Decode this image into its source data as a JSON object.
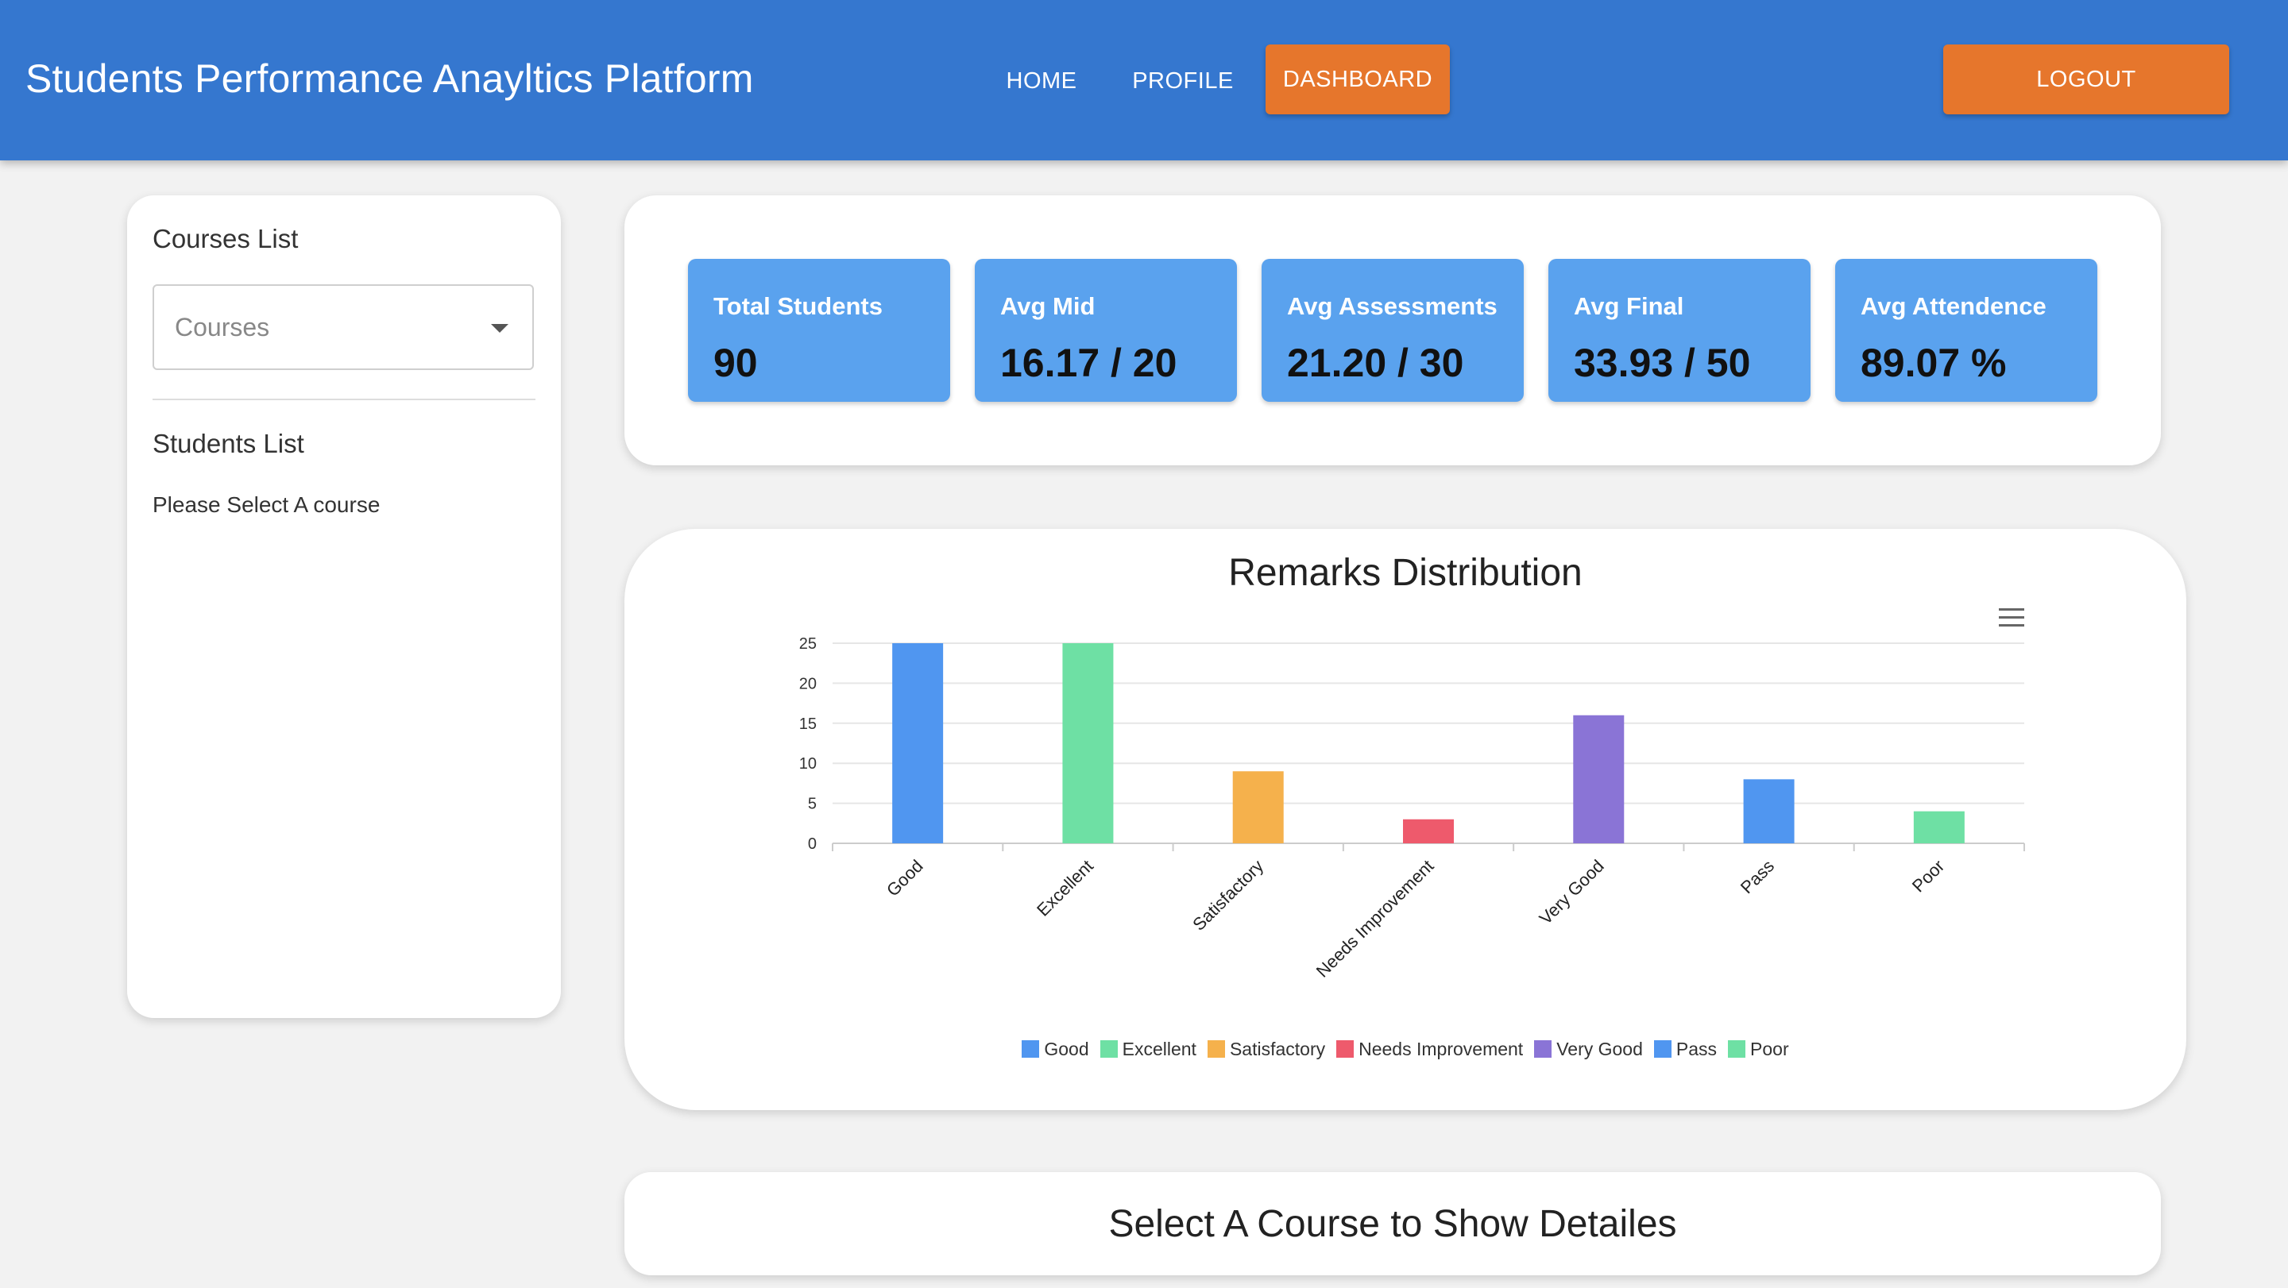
{
  "header": {
    "title": "Students Performance Anayltics Platform",
    "nav": {
      "home": "HOME",
      "profile": "PROFILE",
      "dashboard": "DASHBOARD"
    },
    "logout": "LOGOUT",
    "colors": {
      "bar": "#3577cf",
      "accent": "#e6762c"
    }
  },
  "sidebar": {
    "courses_title": "Courses List",
    "courses_select_placeholder": "Courses",
    "students_title": "Students List",
    "students_empty": "Please Select A course"
  },
  "stats": [
    {
      "label": "Total Students",
      "value": "90"
    },
    {
      "label": "Avg Mid",
      "value": "16.17 / 20"
    },
    {
      "label": "Avg Assessments",
      "value": "21.20 / 30"
    },
    {
      "label": "Avg Final",
      "value": "33.93 / 50"
    },
    {
      "label": "Avg Attendence",
      "value": "89.07 %"
    }
  ],
  "chart_data": {
    "type": "bar",
    "title": "Remarks Distribution",
    "categories": [
      "Good",
      "Excellent",
      "Satisfactory",
      "Needs Improvement",
      "Very Good",
      "Pass",
      "Poor"
    ],
    "values": [
      25,
      25,
      9,
      3,
      16,
      8,
      4
    ],
    "colors": [
      "#5096f0",
      "#6ee0a4",
      "#f5b14c",
      "#ee5a6c",
      "#8a74d6",
      "#5096f0",
      "#6ee0a4"
    ],
    "y_ticks": [
      0,
      5,
      10,
      15,
      20,
      25
    ],
    "ylim": [
      0,
      25
    ],
    "xlabel": "",
    "ylabel": "",
    "grid": true,
    "legend_position": "bottom"
  },
  "details": {
    "placeholder": "Select A Course to Show Detailes"
  }
}
